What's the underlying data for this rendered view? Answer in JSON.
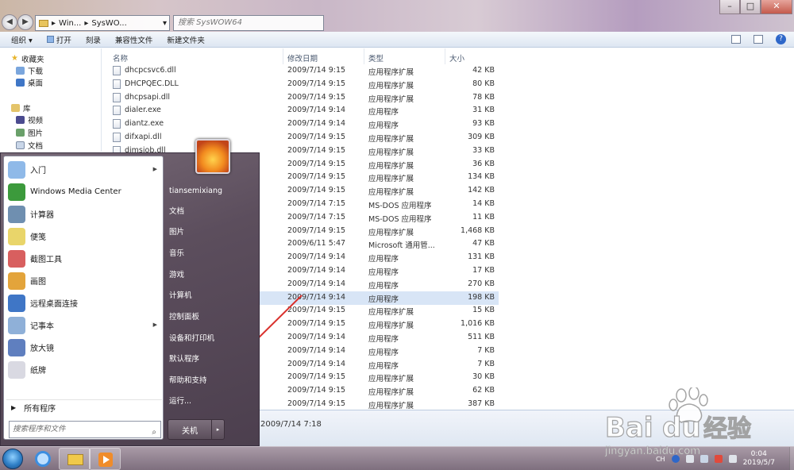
{
  "address": {
    "crumbs": [
      "Win...",
      "SysWO..."
    ],
    "search_placeholder": "搜索 SysWOW64"
  },
  "toolbar": {
    "organize": "组织",
    "open": "打开",
    "burn": "刻录",
    "compat": "兼容性文件",
    "newfolder": "新建文件夹"
  },
  "nav": {
    "favorites": "收藏夹",
    "downloads": "下载",
    "desktop": "桌面",
    "libraries": "库",
    "videos": "视频",
    "pictures": "图片",
    "documents": "文档"
  },
  "columns": {
    "name": "名称",
    "date": "修改日期",
    "type": "类型",
    "size": "大小"
  },
  "files": [
    {
      "name": "dhcpcsvc6.dll",
      "date": "2009/7/14 9:15",
      "type": "应用程序扩展",
      "size": "42 KB"
    },
    {
      "name": "DHCPQEC.DLL",
      "date": "2009/7/14 9:15",
      "type": "应用程序扩展",
      "size": "80 KB"
    },
    {
      "name": "dhcpsapi.dll",
      "date": "2009/7/14 9:15",
      "type": "应用程序扩展",
      "size": "78 KB"
    },
    {
      "name": "dialer.exe",
      "date": "2009/7/14 9:14",
      "type": "应用程序",
      "size": "31 KB"
    },
    {
      "name": "diantz.exe",
      "date": "2009/7/14 9:14",
      "type": "应用程序",
      "size": "93 KB"
    },
    {
      "name": "difxapi.dll",
      "date": "2009/7/14 9:15",
      "type": "应用程序扩展",
      "size": "309 KB"
    },
    {
      "name": "dimsjob.dll",
      "date": "2009/7/14 9:15",
      "type": "应用程序扩展",
      "size": "33 KB"
    },
    {
      "name": "",
      "date": "2009/7/14 9:15",
      "type": "应用程序扩展",
      "size": "36 KB"
    },
    {
      "name": "",
      "date": "2009/7/14 9:15",
      "type": "应用程序扩展",
      "size": "134 KB"
    },
    {
      "name": "",
      "date": "2009/7/14 9:15",
      "type": "应用程序扩展",
      "size": "142 KB"
    },
    {
      "name": "",
      "date": "2009/7/14 7:15",
      "type": "MS-DOS 应用程序",
      "size": "14 KB"
    },
    {
      "name": "",
      "date": "2009/7/14 7:15",
      "type": "MS-DOS 应用程序",
      "size": "11 KB"
    },
    {
      "name": "",
      "date": "2009/7/14 9:15",
      "type": "应用程序扩展",
      "size": "1,468 KB"
    },
    {
      "name": "",
      "date": "2009/6/11 5:47",
      "type": "Microsoft 通用管...",
      "size": "47 KB"
    },
    {
      "name": "",
      "date": "2009/7/14 9:14",
      "type": "应用程序",
      "size": "131 KB"
    },
    {
      "name": "",
      "date": "2009/7/14 9:14",
      "type": "应用程序",
      "size": "17 KB"
    },
    {
      "name": "",
      "date": "2009/7/14 9:14",
      "type": "应用程序",
      "size": "270 KB"
    },
    {
      "name": "",
      "date": "2009/7/14 9:14",
      "type": "应用程序",
      "size": "198 KB"
    },
    {
      "name": "",
      "date": "2009/7/14 9:15",
      "type": "应用程序扩展",
      "size": "15 KB"
    },
    {
      "name": "",
      "date": "2009/7/14 9:15",
      "type": "应用程序扩展",
      "size": "1,016 KB"
    },
    {
      "name": "",
      "date": "2009/7/14 9:14",
      "type": "应用程序",
      "size": "511 KB"
    },
    {
      "name": "",
      "date": "2009/7/14 9:14",
      "type": "应用程序",
      "size": "7 KB"
    },
    {
      "name": "",
      "date": "2009/7/14 9:14",
      "type": "应用程序",
      "size": "7 KB"
    },
    {
      "name": "",
      "date": "2009/7/14 9:15",
      "type": "应用程序扩展",
      "size": "30 KB"
    },
    {
      "name": "",
      "date": "2009/7/14 9:15",
      "type": "应用程序扩展",
      "size": "62 KB"
    },
    {
      "name": "",
      "date": "2009/7/14 9:15",
      "type": "应用程序扩展",
      "size": "387 KB"
    }
  ],
  "details": {
    "date": "2009/7/14 7:18"
  },
  "startmenu": {
    "programs": [
      {
        "label": "入门",
        "icon": "getting-started-icon",
        "arrow": true
      },
      {
        "label": "Windows Media Center",
        "icon": "media-center-icon",
        "arrow": false
      },
      {
        "label": "计算器",
        "icon": "calculator-icon",
        "arrow": false
      },
      {
        "label": "便笺",
        "icon": "sticky-notes-icon",
        "arrow": false
      },
      {
        "label": "截图工具",
        "icon": "snipping-tool-icon",
        "arrow": false
      },
      {
        "label": "画图",
        "icon": "paint-icon",
        "arrow": false
      },
      {
        "label": "远程桌面连接",
        "icon": "remote-desktop-icon",
        "arrow": false
      },
      {
        "label": "记事本",
        "icon": "notepad-icon",
        "arrow": true
      },
      {
        "label": "放大镜",
        "icon": "magnifier-icon",
        "arrow": false
      },
      {
        "label": "纸牌",
        "icon": "solitaire-icon",
        "arrow": false
      }
    ],
    "all_programs": "所有程序",
    "search_placeholder": "搜索程序和文件",
    "user": "tiansemixiang",
    "right": [
      "文档",
      "图片",
      "音乐",
      "游戏",
      "计算机",
      "控制面板",
      "设备和打印机",
      "默认程序",
      "帮助和支持",
      "运行..."
    ],
    "shutdown": "关机"
  },
  "tray": {
    "lang": "CH",
    "time": "0:04",
    "date": "2019/5/7"
  },
  "watermark": {
    "brand": "Bai",
    "brand2": "du",
    "cn": "经验",
    "url": "jingyan.baidu.com"
  },
  "colors": {
    "selection": "#d8e5f6",
    "arrow": "#d9302c",
    "accent": "#2f7fc6"
  }
}
